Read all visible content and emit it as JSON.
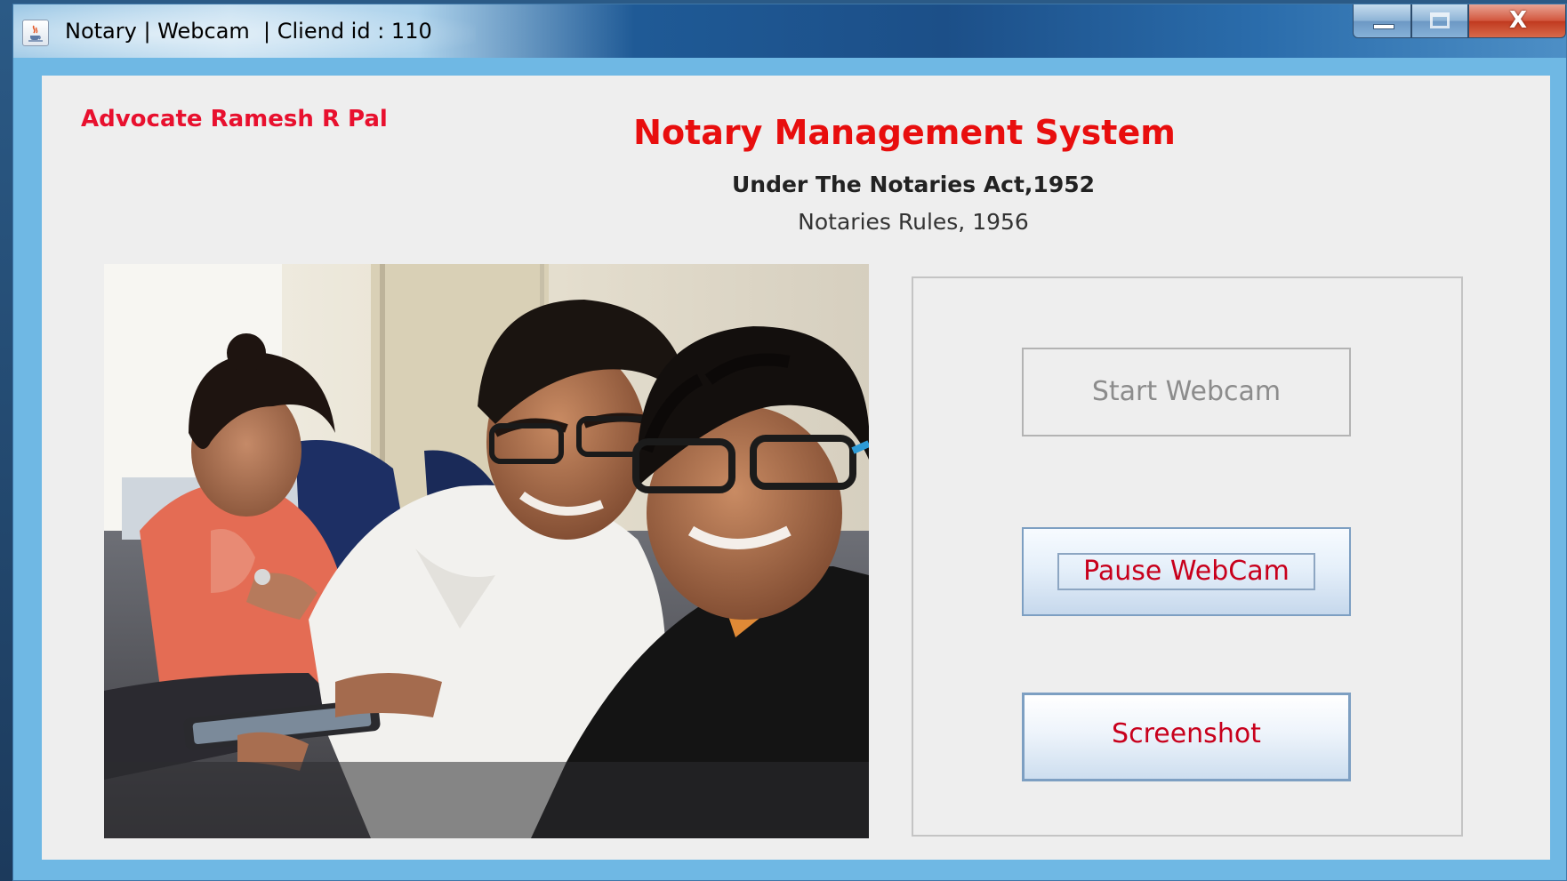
{
  "window": {
    "title": "Notary | Webcam  | Cliend id : 110",
    "icon": "java-cup-icon",
    "controls": {
      "minimize_icon": "minimize-icon",
      "maximize_icon": "maximize-icon",
      "close_icon": "close-icon",
      "close_glyph": "X"
    }
  },
  "header": {
    "advocate_name": "Advocate Ramesh R Pal",
    "app_title": "Notary Management System",
    "subtitle": "Under The Notaries Act,1952",
    "rules": "Notaries Rules, 1956"
  },
  "webcam": {
    "content": "live-webcam-frame"
  },
  "controls": {
    "start_label": "Start Webcam",
    "start_enabled": false,
    "pause_label": "Pause WebCam",
    "screenshot_label": "Screenshot"
  },
  "colors": {
    "accent_red": "#e80e0e",
    "window_border_blue": "#6fb8e4",
    "panel_bg": "#eeeeee"
  }
}
